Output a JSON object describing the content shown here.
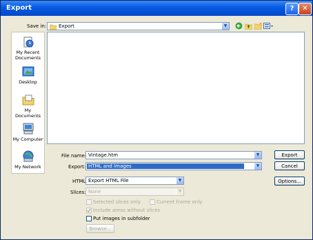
{
  "window": {
    "title": "Export",
    "help_label": "?",
    "close_label": "✕"
  },
  "savein": {
    "label": "Save in:",
    "value": "Export"
  },
  "places": [
    {
      "label": "My Recent Documents",
      "icon": "recent-documents-icon"
    },
    {
      "label": "Desktop",
      "icon": "desktop-icon"
    },
    {
      "label": "My Documents",
      "icon": "my-documents-icon"
    },
    {
      "label": "My Computer",
      "icon": "my-computer-icon"
    },
    {
      "label": "My Network",
      "icon": "my-network-icon"
    }
  ],
  "form": {
    "filename_label": "File name:",
    "filename_value": "Vintage.htm",
    "export_label": "Export:",
    "export_value": "HTML and Images",
    "html_label": "HTML:",
    "html_value": "Export HTML File",
    "slices_label": "Slices:",
    "slices_value": "None",
    "selected_slices_only": "Selected slices only",
    "current_frame_only": "Current frame only",
    "include_areas": "Include areas without slices",
    "put_images": "Put images in subfolder",
    "browse": "Browse..."
  },
  "buttons": {
    "export": "Export",
    "cancel": "Cancel",
    "options": "Options..."
  },
  "colors": {
    "titlebar": "#0a5de5",
    "selection": "#316ac5",
    "dialog_bg": "#ece9d8"
  }
}
